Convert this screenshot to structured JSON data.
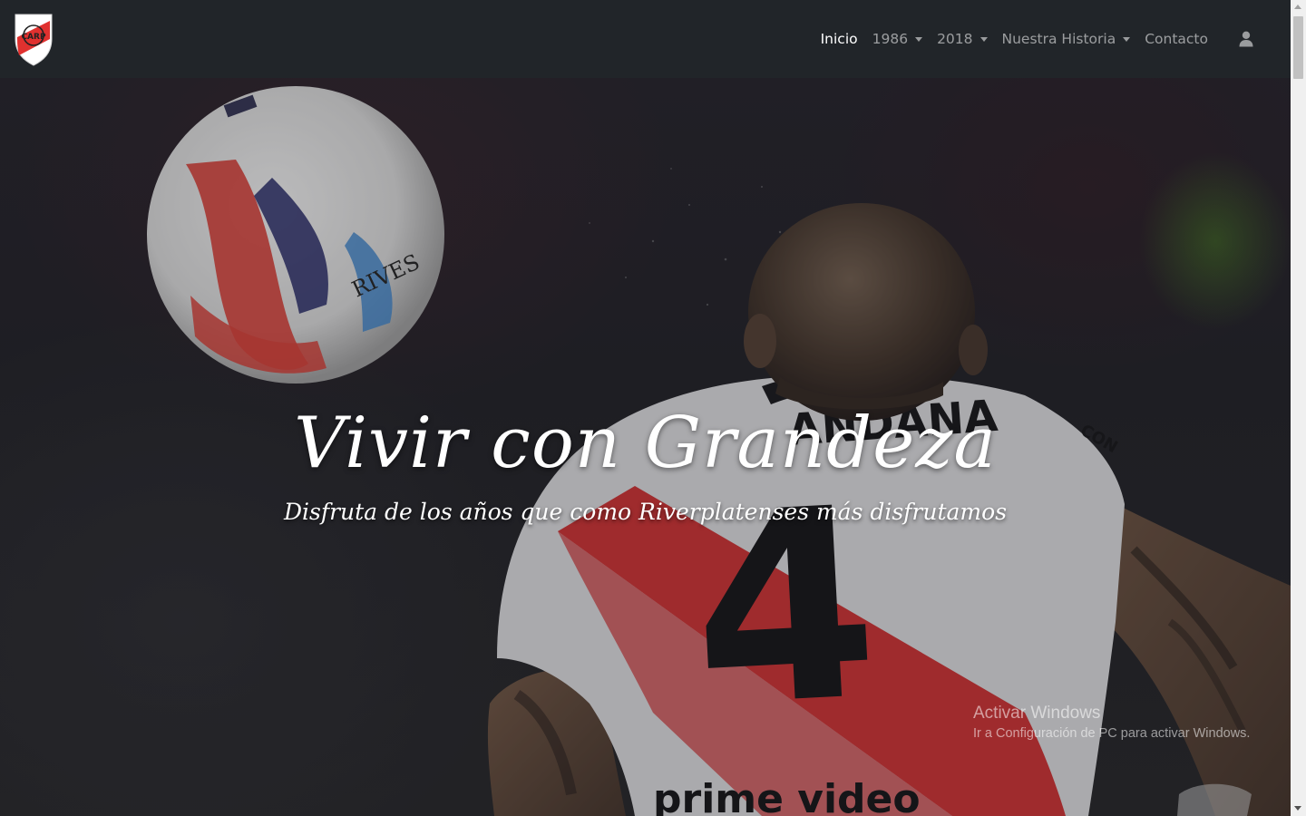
{
  "navbar": {
    "brand_icon": "river-plate-crest-icon",
    "items": [
      {
        "label": "Inicio",
        "active": true,
        "dropdown": false
      },
      {
        "label": "1986",
        "active": false,
        "dropdown": true
      },
      {
        "label": "2018",
        "active": false,
        "dropdown": true
      },
      {
        "label": "Nuestra Historia",
        "active": false,
        "dropdown": true
      },
      {
        "label": "Contacto",
        "active": false,
        "dropdown": false
      }
    ],
    "user_icon": "user-icon"
  },
  "hero": {
    "title": "Vivir con Grandeza",
    "subtitle": "Disfruta de los años que como Riverplatenses más disfrutamos",
    "jersey_name": "ANDANA",
    "jersey_number": "4",
    "ball_text": "RIVES",
    "sleeve_text": "CON",
    "sponsor_text": "prime video"
  },
  "watermark": {
    "line1": "Activar Windows",
    "line2": "Ir a Configuración de PC para activar Windows."
  },
  "colors": {
    "navbar_bg": "#212529",
    "accent_red": "#e0312f",
    "text_white": "#ffffff",
    "nav_muted": "rgba(255,255,255,0.55)"
  }
}
